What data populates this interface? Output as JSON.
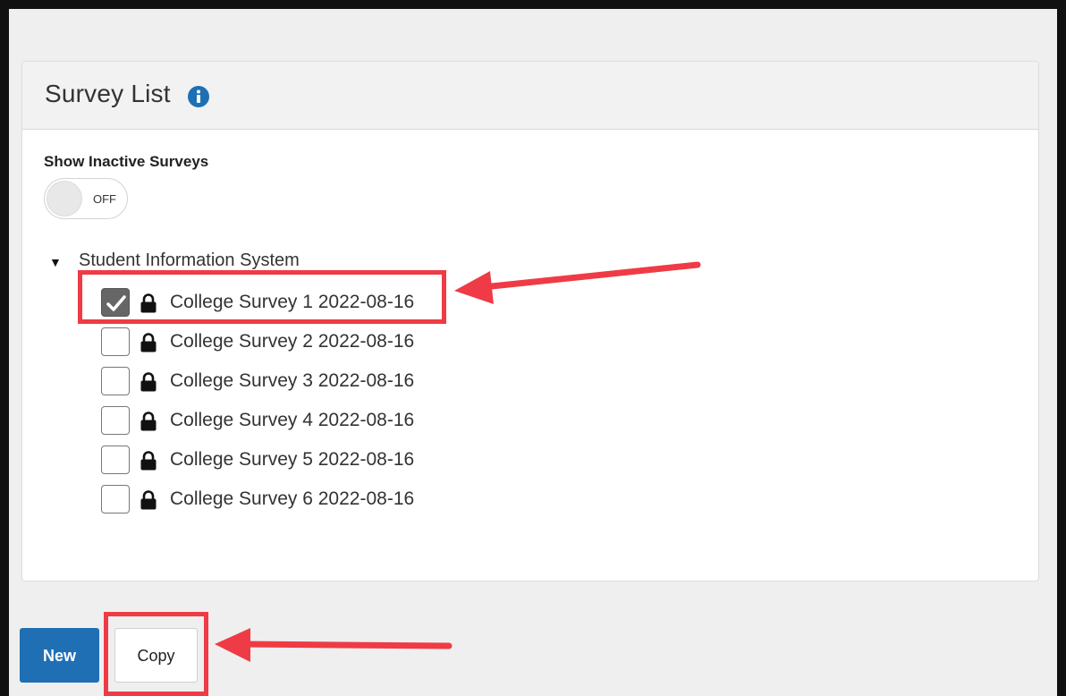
{
  "panel": {
    "title": "Survey List",
    "info_icon": "info-icon"
  },
  "toggle": {
    "label": "Show Inactive Surveys",
    "state_text": "OFF",
    "on": false
  },
  "tree": {
    "root_label": "Student Information System",
    "expanded": true,
    "items": [
      {
        "label": "College Survey 1 2022-08-16",
        "checked": true,
        "locked": true
      },
      {
        "label": "College Survey 2 2022-08-16",
        "checked": false,
        "locked": true
      },
      {
        "label": "College Survey 3 2022-08-16",
        "checked": false,
        "locked": true
      },
      {
        "label": "College Survey 4 2022-08-16",
        "checked": false,
        "locked": true
      },
      {
        "label": "College Survey 5 2022-08-16",
        "checked": false,
        "locked": true
      },
      {
        "label": "College Survey 6 2022-08-16",
        "checked": false,
        "locked": true
      }
    ]
  },
  "actions": {
    "new_label": "New",
    "copy_label": "Copy"
  },
  "colors": {
    "primary": "#1f6fb5",
    "highlight": "#ef3b45",
    "checkbox_checked": "#666666"
  }
}
